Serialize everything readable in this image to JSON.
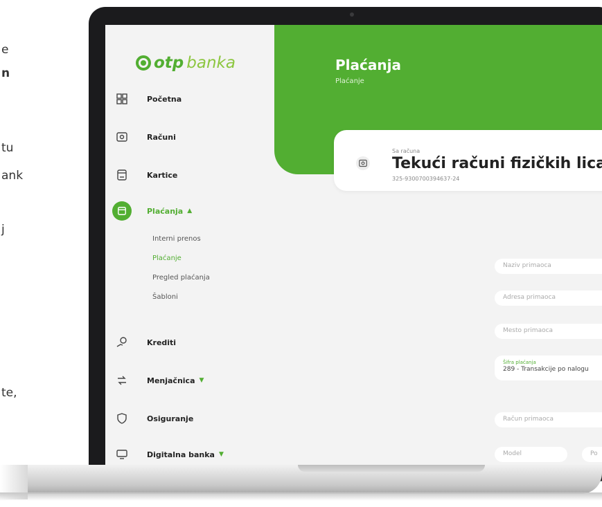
{
  "side_text": [
    "e",
    "n",
    "tu",
    "ank",
    "j",
    "te,"
  ],
  "logo": {
    "primary": "otp",
    "secondary": "banka"
  },
  "nav": {
    "home": "Početna",
    "accounts": "Računi",
    "cards": "Kartice",
    "payments": "Plaćanja",
    "payments_sub": [
      "Interni prenos",
      "Plaćanje",
      "Pregled plaćanja",
      "Šabloni"
    ],
    "loans": "Krediti",
    "exchange": "Menjačnica",
    "insurance": "Osiguranje",
    "digital": "Digitalna banka"
  },
  "header": {
    "title": "Plaćanja",
    "subtitle": "Plaćanje"
  },
  "account_card": {
    "label": "Sa računa",
    "title": "Tekući računi fizičkih lica u",
    "number": "325-9300700394637-24"
  },
  "form": {
    "recipient_name": "Naziv primaoca",
    "recipient_address": "Adresa primaoca",
    "recipient_place": "Mesto primaoca",
    "payment_code_label": "Šifra plaćanja",
    "payment_code_value": "289 - Transakcije po nalogu",
    "recipient_account": "Račun primaoca",
    "model": "Model",
    "next_field": "Po"
  },
  "colors": {
    "brand": "#52ae32",
    "brand_light": "#8cc63f",
    "frame": "#1b1b1d",
    "background": "#f3f3f3"
  }
}
